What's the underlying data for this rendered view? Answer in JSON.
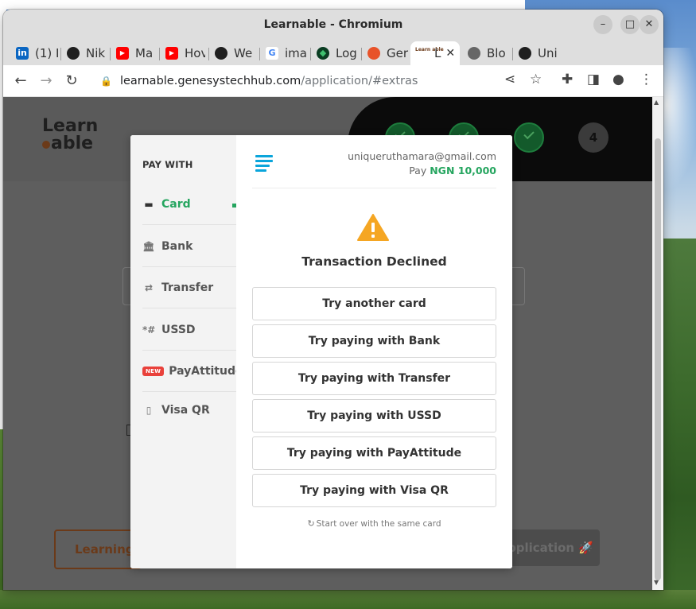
{
  "window": {
    "title": "Learnable - Chromium",
    "minimize_label": "–",
    "maximize_label": "□",
    "close_label": "✕"
  },
  "tabs": [
    {
      "label": "(1) I",
      "icon": "linkedin-icon",
      "color": "#0a66c2"
    },
    {
      "label": "Nik",
      "icon": "github-icon",
      "color": "#1f1f1f"
    },
    {
      "label": "Ma",
      "icon": "youtube-icon",
      "color": "#ff0000"
    },
    {
      "label": "Hov",
      "icon": "youtube-icon",
      "color": "#ff0000"
    },
    {
      "label": "We",
      "icon": "github-icon",
      "color": "#1f1f1f"
    },
    {
      "label": "ima",
      "icon": "google-icon",
      "color": "#4285f4"
    },
    {
      "label": "Log",
      "icon": "mongodb-icon",
      "color": "#0a7a3f"
    },
    {
      "label": "Ger",
      "icon": "gen-icon",
      "color": "#e8532a"
    },
    {
      "label": "L",
      "icon": "learnable-icon",
      "color": "#6b3a19",
      "active": true
    },
    {
      "label": "Blo",
      "icon": "globe-icon",
      "color": "#555555"
    },
    {
      "label": "Uni",
      "icon": "github-icon",
      "color": "#1f1f1f"
    }
  ],
  "toolbar": {
    "url_host": "learnable.genesystechhub.com",
    "url_path": "/application/#extras"
  },
  "page": {
    "logo_top": "Learn",
    "logo_bottom": "able",
    "step4_label": "4",
    "left_button": "Learning",
    "right_button": "pplication 🚀"
  },
  "modal": {
    "pay_with": "PAY WITH",
    "methods": [
      {
        "label": "Card",
        "icon": "card-icon",
        "active": true
      },
      {
        "label": "Bank",
        "icon": "bank-icon"
      },
      {
        "label": "Transfer",
        "icon": "transfer-icon"
      },
      {
        "label": "USSD",
        "icon": "ussd-icon"
      },
      {
        "label": "PayAttitude",
        "icon": "payattitude-icon",
        "badge": "NEW"
      },
      {
        "label": "Visa QR",
        "icon": "qr-icon"
      }
    ],
    "email": "uniqueruthamara@gmail.com",
    "pay_prefix": "Pay",
    "amount": "NGN 10,000",
    "status_title": "Transaction Declined",
    "options": [
      "Try another card",
      "Try paying with Bank",
      "Try paying with Transfer",
      "Try paying with USSD",
      "Try paying with PayAttitude",
      "Try paying with Visa QR"
    ],
    "start_over": "Start over with the same card",
    "close_label": "×"
  },
  "colors": {
    "accent_green": "#25a55f",
    "warning_orange": "#f5a623",
    "brand_blue": "#0aa5db"
  }
}
